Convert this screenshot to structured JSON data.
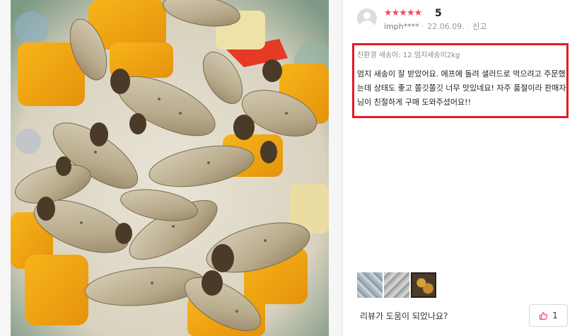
{
  "review": {
    "rating_stars": "★★★★★",
    "rating_score": "5",
    "author": "imph****",
    "date": "22.06.09.",
    "report_label": "신고",
    "option_text": "친환경 새송이: 12.엄지새송이2kg",
    "content": "엄지 새송이 잘 받았어요. 에프에 돌려 샐러드로 먹으려고 주문했는데 상태도 좋고 쫄깃쫄깃 너무 맛있네요! 자주 품절이라 판매자님이 친절하게 구매 도와주셨어요!!",
    "helpful_question": "리뷰가 도움이 되었나요?",
    "like_count": "1"
  },
  "colors": {
    "star": "#f5475f",
    "highlight_border": "#e41a25",
    "thumb_icon": "#f5475f"
  },
  "icons": [
    "avatar-icon",
    "thumbs-up-icon"
  ]
}
